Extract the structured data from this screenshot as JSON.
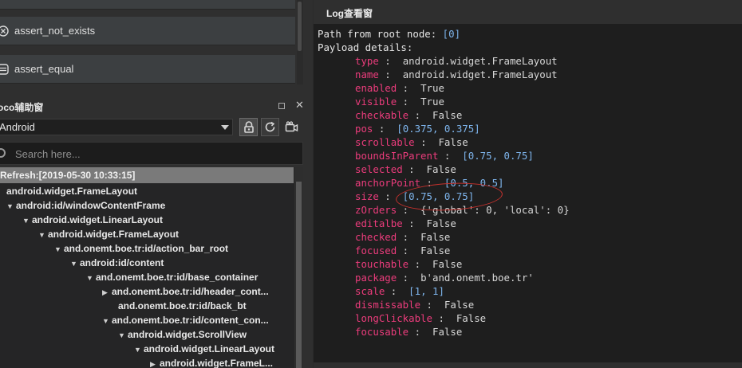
{
  "asserts": {
    "top_label": "",
    "not_exists_label": "assert_not_exists",
    "equal_label": "assert_equal"
  },
  "poco_panel": {
    "title": "oco辅助窗",
    "platform_value": "Android",
    "search_placeholder": "Search here..."
  },
  "tree": {
    "refresh_label": "Refresh:[2019-05-30 10:33:15]",
    "rows": [
      {
        "label": "android.widget.FrameLayout",
        "arrow": ""
      },
      {
        "label": "android:id/windowContentFrame",
        "arrow": "▼"
      },
      {
        "label": "android.widget.LinearLayout",
        "arrow": "▼"
      },
      {
        "label": "android.widget.FrameLayout",
        "arrow": "▼"
      },
      {
        "label": "and.onemt.boe.tr:id/action_bar_root",
        "arrow": "▼"
      },
      {
        "label": "android:id/content",
        "arrow": "▼"
      },
      {
        "label": "and.onemt.boe.tr:id/base_container",
        "arrow": "▼"
      },
      {
        "label": "and.onemt.boe.tr:id/header_cont...",
        "arrow": "▶"
      },
      {
        "label": "and.onemt.boe.tr:id/back_bt",
        "arrow": ""
      },
      {
        "label": "and.onemt.boe.tr:id/content_con...",
        "arrow": "▼"
      },
      {
        "label": "android.widget.ScrollView",
        "arrow": "▼"
      },
      {
        "label": "android.widget.LinearLayout",
        "arrow": "▼"
      },
      {
        "label": "android.widget.FrameL...",
        "arrow": "▶"
      }
    ]
  },
  "log": {
    "title": "Log查看窗",
    "path_label": "Path from root node: ",
    "path_value": "[0]",
    "payload_label": "Payload details:",
    "fields": [
      {
        "key": "type",
        "sep": " :  ",
        "value": "android.widget.FrameLayout",
        "kind": "text"
      },
      {
        "key": "name",
        "sep": " :  ",
        "value": "android.widget.FrameLayout",
        "kind": "text"
      },
      {
        "key": "enabled",
        "sep": " :  ",
        "value": "True",
        "kind": "text"
      },
      {
        "key": "visible",
        "sep": " :  ",
        "value": "True",
        "kind": "text"
      },
      {
        "key": "checkable",
        "sep": " :  ",
        "value": "False",
        "kind": "text"
      },
      {
        "key": "pos",
        "sep": " :  ",
        "value": "[0.375, 0.375]",
        "kind": "num"
      },
      {
        "key": "scrollable",
        "sep": " :  ",
        "value": "False",
        "kind": "text"
      },
      {
        "key": "boundsInParent",
        "sep": " :  ",
        "value": "[0.75, 0.75]",
        "kind": "num"
      },
      {
        "key": "selected",
        "sep": " :  ",
        "value": "False",
        "kind": "text"
      },
      {
        "key": "anchorPoint",
        "sep": " :  ",
        "value": "[0.5, 0.5]",
        "kind": "num"
      },
      {
        "key": "size",
        "sep": " :  ",
        "value": "[0.75, 0.75]",
        "kind": "num"
      },
      {
        "key": "zOrders",
        "sep": " :  ",
        "value": "{'global': 0, 'local': 0}",
        "kind": "text"
      },
      {
        "key": "editalbe",
        "sep": " :  ",
        "value": "False",
        "kind": "text"
      },
      {
        "key": "checked",
        "sep": " :  ",
        "value": "False",
        "kind": "text"
      },
      {
        "key": "focused",
        "sep": " :  ",
        "value": "False",
        "kind": "text"
      },
      {
        "key": "touchable",
        "sep": " :  ",
        "value": "False",
        "kind": "text"
      },
      {
        "key": "package",
        "sep": " :  ",
        "value": "b'and.onemt.boe.tr'",
        "kind": "text"
      },
      {
        "key": "scale",
        "sep": " :  ",
        "value": "[1, 1]",
        "kind": "num"
      },
      {
        "key": "dismissable",
        "sep": " :  ",
        "value": "False",
        "kind": "text"
      },
      {
        "key": "longClickable",
        "sep": " :  ",
        "value": "False",
        "kind": "text"
      },
      {
        "key": "focusable",
        "sep": " :  ",
        "value": "False",
        "kind": "text"
      }
    ],
    "highlight_color": "#c4312d",
    "key_color": "#ec3c7c",
    "number_color": "#7fb6ee"
  }
}
